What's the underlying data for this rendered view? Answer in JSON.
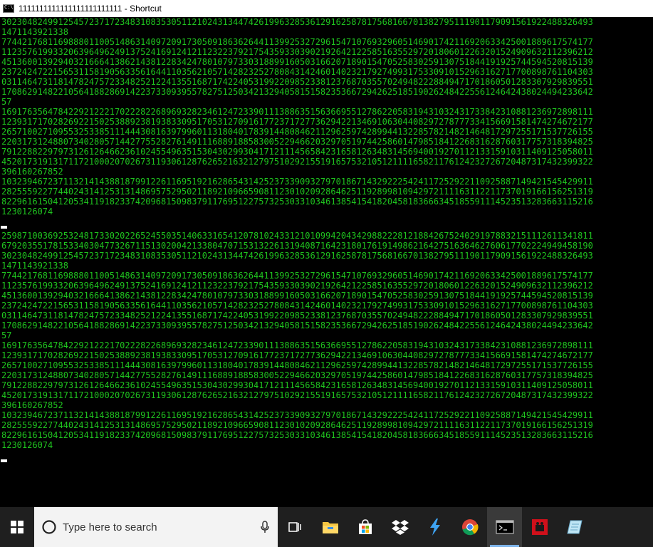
{
  "window": {
    "title": "1111111111111111111111111 - Shortcut"
  },
  "console": {
    "lines": [
      "3023048249912545723717234831083530511210243134474261996328536129162587817568166701382795111901179091561922488326493",
      "1471143921338",
      "7744217681169888011005148631409720917305091863626441139925327296154710769329605146901742116920633425001889617574177",
      "1123576199332063964962491375241691241211232237921754359330390219264212258516355297201806012263201524909632112396212",
      "4513600139294032166641386214381228342478010797330318899160503166207189015470525830259130751844191925744594520815139",
      "2372424722156531158190563356164411035621057142823252780843142460140232179274993175330910152963162717700898761104303",
      "0311464731181478247572334825212241355168717422405319922098523381237687035570249482228849471701860501283307929839551",
      "1708629148221056418828691422373309395578275125034213294058151582353667294262518519026248422556124642438024494233642",
      "57",
      "1691763564784229212221702228226896932823461247233901113886351563669551278622058319431032431733842310881236972898111",
      "1239317170282692215025388923819383309517053127091617723717277362942213469106304408297278777334156691581474274672177",
      "2657100271095532533851114443081639799601131804017839144808462112962597428994413228578214821464817297255171537726155",
      "2203173124880734028057144277552827614911168891885830052294662032970519744258601479851841226831628760317757318394825",
      "7912288229797312612646623610245549635153043029930417121114565842316581263483145694001927011213315910311409125058011",
      "4520173191317117210002070267311930612876265216321279751029215519165753210512111165821176124232726720487317432399322",
      "396160267852",
      "1032394672371132141438818799122611695192162865431425237339093279701867143292225424117252922110925887149421545429911",
      "2825559227744024314125313148695752950211892109665908112301020928646251192899810942972111163112211737019166156251319",
      "8229616150412053411918233742096815098379117695122757325303310346138541541820458183666345185591114523513283663115216",
      "1230126074",
      "",
      "CURSOR",
      "2598710036925324817330202265245503514063316541207810243312101099420434298822281218842675240291978832151112611341811",
      "6792035517815334030477326711513020042133804707153132261319408716423180176191498621642751636462760617702224949458190",
      "3023048249912545723717234831083530511210243134474261996328536129162587817568166701382795111901179091561922488326493",
      "1471143921338",
      "7744217681169888011005148631409720917305091863626441139925327296154710769329605146901742116920633425001889617574177",
      "1123576199332063964962491375241691241211232237921754359330390219264212258516355297201806012263201524909632112396212",
      "4513600139294032166641386214381228342478010797330318899160503166207189015470525830259130751844191925744594520815139",
      "2372424722156531158190563356164411035621057142823252780843142460140232179274993175330910152963162717700898761104303",
      "0311464731181478247572334825212241355168717422405319922098523381237687035570249482228849471701860501283307929839551",
      "1708629148221056418828691422373309395578275125034213294058151582353667294262518519026248422556124642438024494233642",
      "57",
      "1691763564784229212221702228226896932823461247233901113886351563669551278622058319431032431733842310881236972898111",
      "1239317170282692215025388923819383309517053127091617723717277362942213469106304408297278777334156691581474274672177",
      "2657100271095532533851114443081639799601131804017839144808462112962597428994413228578214821464817297255171537726155",
      "2203173124880734028057144277552827614911168891885830052294662032970519744258601479851841226831628760317757318394825",
      "7912288229797312612646623610245549635153043029930417121114565842316581263483145694001927011213315910311409125058011",
      "4520173191317117210002070267311930612876265216321279751029215519165753210512111165821176124232726720487317432399322",
      "396160267852",
      "1032394672371132141438818799122611695192162865431425237339093279701867143292225424117252922110925887149421545429911",
      "2825559227744024314125313148695752950211892109665908112301020928646251192899810942972111163112211737019166156251319",
      "8229616150412053411918233742096815098379117695122757325303310346138541541820458183666345185591114523513283663115216",
      "1230126074",
      "",
      "CURSOR"
    ]
  },
  "taskbar": {
    "search_placeholder": "Type here to search",
    "icons": [
      "windows-start-icon",
      "microphone-icon",
      "task-view-icon",
      "file-explorer-icon",
      "store-icon",
      "dropbox-icon",
      "visual-studio-icon",
      "chrome-icon",
      "command-prompt-icon",
      "red-app-icon",
      "notepad-icon"
    ]
  },
  "colors": {
    "console_text": "#1fc41f",
    "console_bg": "#000000",
    "taskbar_bg": "#1f1f1f",
    "accent": "#7eb4ea"
  }
}
